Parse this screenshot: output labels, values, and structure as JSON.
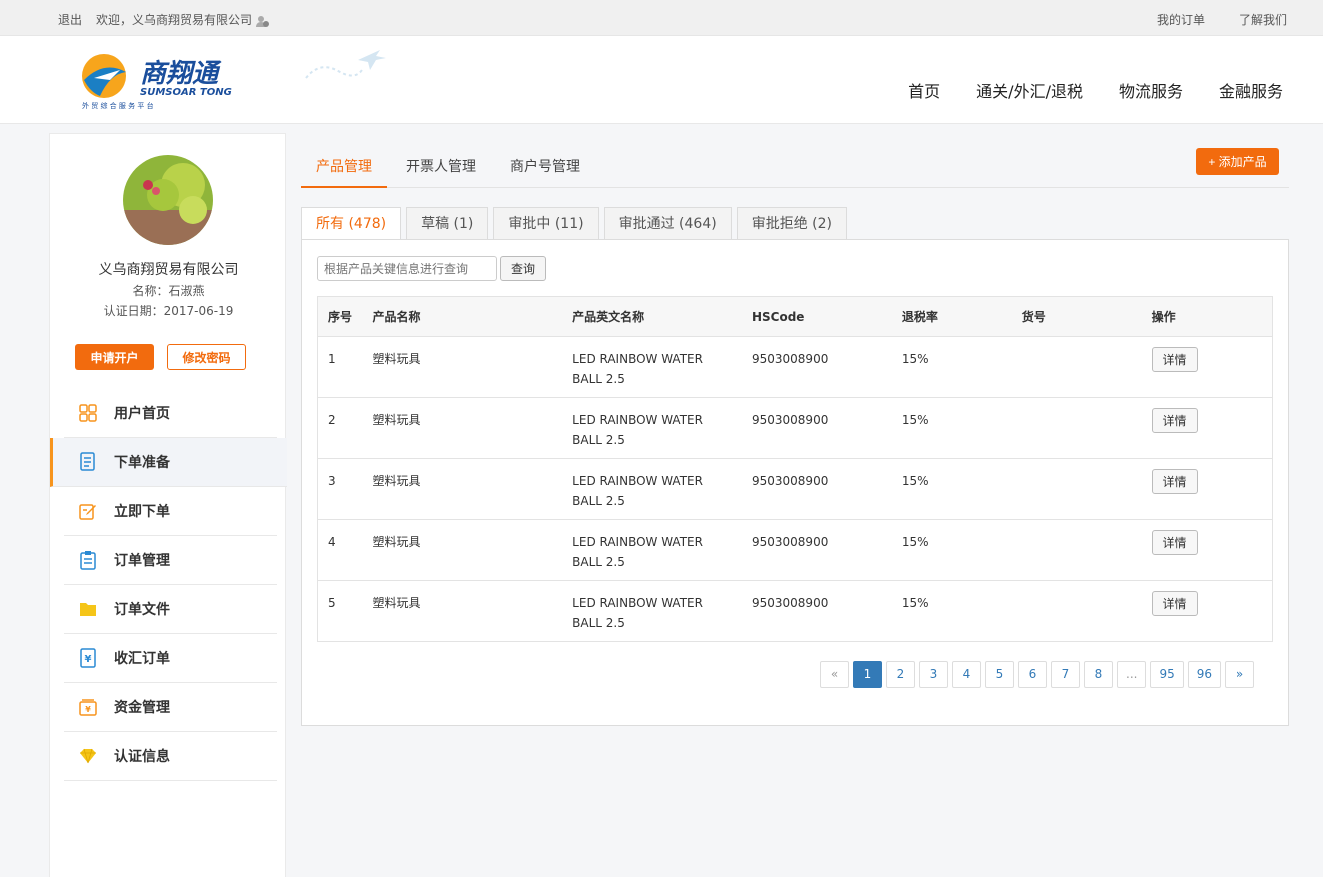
{
  "topbar": {
    "logout": "退出",
    "welcome": "欢迎，义乌商翔贸易有限公司",
    "my_orders": "我的订单",
    "about_us": "了解我们"
  },
  "header": {
    "logo_cn": "商翔通",
    "logo_en": "SUMSOAR TONG",
    "logo_sub": "外 贸 综 合 服 务 平 台",
    "nav": [
      "首页",
      "通关/外汇/退税",
      "物流服务",
      "金融服务"
    ]
  },
  "sidebar": {
    "company": "义乌商翔贸易有限公司",
    "name_line": "名称：石淑燕",
    "date_line": "认证日期：2017-06-19",
    "apply_btn": "申请开户",
    "pwd_btn": "修改密码",
    "items": [
      {
        "label": "用户首页",
        "icon": "grid-icon"
      },
      {
        "label": "下单准备",
        "icon": "document-icon"
      },
      {
        "label": "立即下单",
        "icon": "edit-icon"
      },
      {
        "label": "订单管理",
        "icon": "clipboard-icon"
      },
      {
        "label": "订单文件",
        "icon": "folder-icon"
      },
      {
        "label": "收汇订单",
        "icon": "yen-document-icon"
      },
      {
        "label": "资金管理",
        "icon": "wallet-icon"
      },
      {
        "label": "认证信息",
        "icon": "diamond-icon"
      }
    ]
  },
  "main": {
    "tabs": [
      "产品管理",
      "开票人管理",
      "商户号管理"
    ],
    "add_btn": "+ 添加产品",
    "filters": [
      "所有 (478)",
      "草稿 (1)",
      "审批中 (11)",
      "审批通过 (464)",
      "审批拒绝 (2)"
    ],
    "search_placeholder": "根据产品关键信息进行查询",
    "search_btn": "查询",
    "columns": [
      "序号",
      "产品名称",
      "产品英文名称",
      "HSCode",
      "退税率",
      "货号",
      "操作"
    ],
    "rows": [
      {
        "no": "1",
        "name": "塑料玩具",
        "en1": "LED RAINBOW WATER",
        "en2": "BALL 2.5",
        "hs": "9503008900",
        "rate": "15%",
        "sku": "",
        "action": "详情"
      },
      {
        "no": "2",
        "name": "塑料玩具",
        "en1": "LED RAINBOW WATER",
        "en2": "BALL 2.5",
        "hs": "9503008900",
        "rate": "15%",
        "sku": "",
        "action": "详情"
      },
      {
        "no": "3",
        "name": "塑料玩具",
        "en1": "LED RAINBOW WATER",
        "en2": "BALL 2.5",
        "hs": "9503008900",
        "rate": "15%",
        "sku": "",
        "action": "详情"
      },
      {
        "no": "4",
        "name": "塑料玩具",
        "en1": "LED RAINBOW WATER",
        "en2": "BALL 2.5",
        "hs": "9503008900",
        "rate": "15%",
        "sku": "",
        "action": "详情"
      },
      {
        "no": "5",
        "name": "塑料玩具",
        "en1": "LED RAINBOW WATER",
        "en2": "BALL 2.5",
        "hs": "9503008900",
        "rate": "15%",
        "sku": "",
        "action": "详情"
      }
    ],
    "pager": [
      "«",
      "1",
      "2",
      "3",
      "4",
      "5",
      "6",
      "7",
      "8",
      "...",
      "95",
      "96",
      "»"
    ],
    "current_page": "1"
  },
  "colors": {
    "accent": "#f26b0e",
    "pager_active": "#337ab7"
  }
}
